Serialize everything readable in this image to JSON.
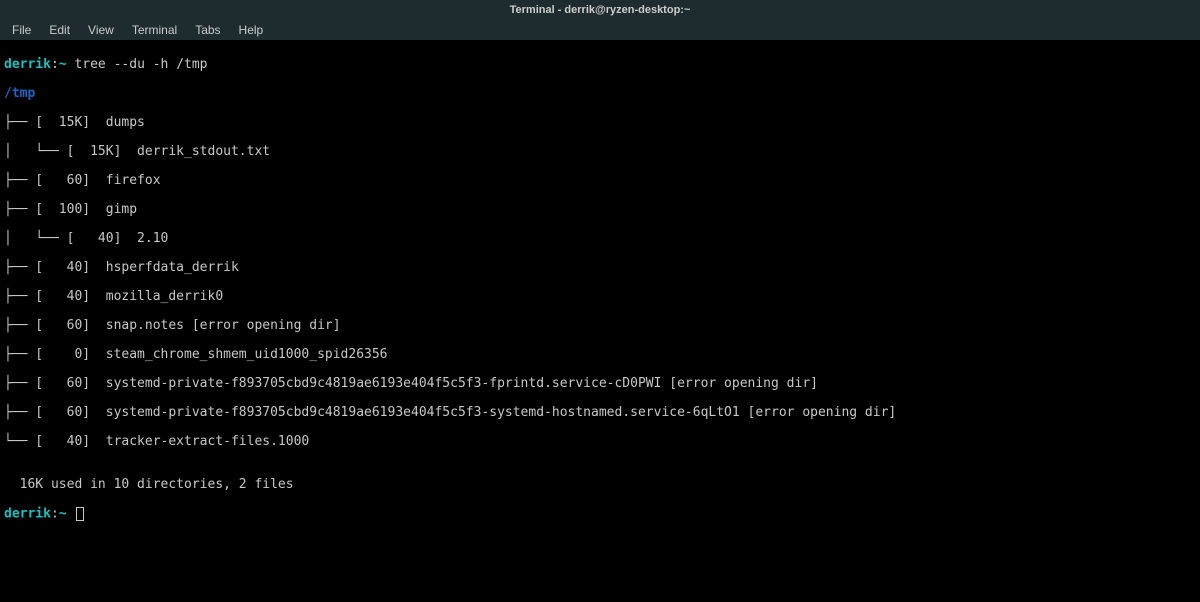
{
  "window": {
    "title": "Terminal - derrik@ryzen-desktop:~"
  },
  "menu": {
    "file": "File",
    "edit": "Edit",
    "view": "View",
    "terminal": "Terminal",
    "tabs": "Tabs",
    "help": "Help"
  },
  "prompt": {
    "user": "derrik",
    "sep1": ":",
    "tilde": "~",
    "cmd": " tree --du -h /tmp"
  },
  "output": {
    "root": "/tmp",
    "lines": [
      "├── [  15K]  dumps",
      "│   └── [  15K]  derrik_stdout.txt",
      "├── [   60]  firefox",
      "├── [  100]  gimp",
      "│   └── [   40]  2.10",
      "├── [   40]  hsperfdata_derrik",
      "├── [   40]  mozilla_derrik0",
      "├── [   60]  snap.notes [error opening dir]",
      "├── [    0]  steam_chrome_shmem_uid1000_spid26356",
      "├── [   60]  systemd-private-f893705cbd9c4819ae6193e404f5c5f3-fprintd.service-cD0PWI [error opening dir]",
      "├── [   60]  systemd-private-f893705cbd9c4819ae6193e404f5c5f3-systemd-hostnamed.service-6qLtO1 [error opening dir]",
      "└── [   40]  tracker-extract-files.1000"
    ],
    "blank": "",
    "summary": "  16K used in 10 directories, 2 files"
  },
  "prompt2": {
    "user": "derrik",
    "sep1": ":",
    "tilde": "~"
  }
}
